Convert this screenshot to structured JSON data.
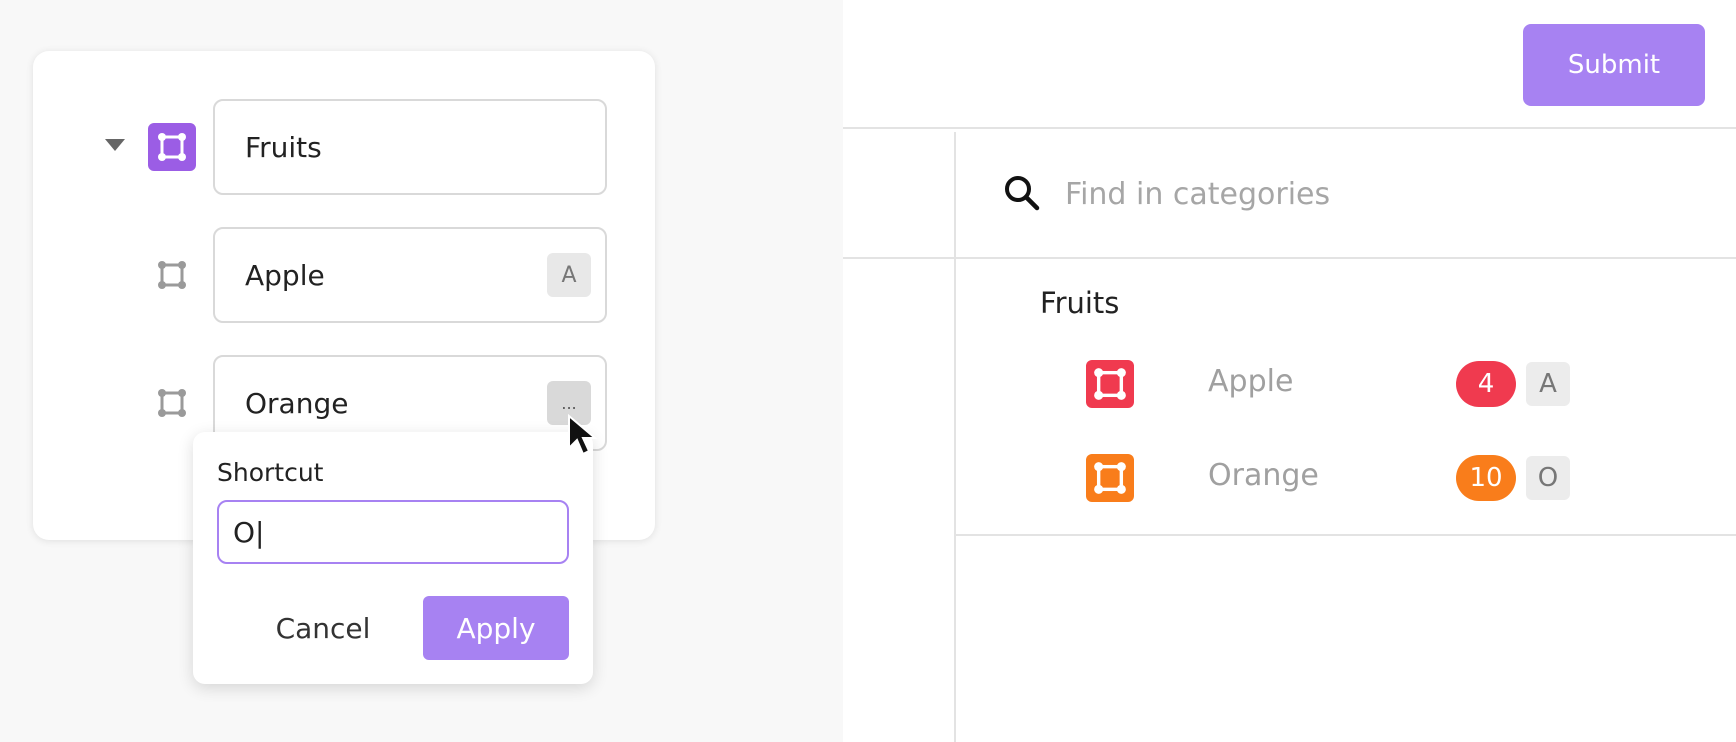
{
  "tree": {
    "items": [
      {
        "name": "Fruits",
        "icon": "category-icon",
        "expanded": true
      },
      {
        "name": "Apple",
        "icon": "category-icon",
        "shortcut": "A"
      },
      {
        "name": "Orange",
        "icon": "category-icon",
        "shortcut": "..."
      }
    ]
  },
  "popover": {
    "label": "Shortcut",
    "value": "O|",
    "cancel_label": "Cancel",
    "apply_label": "Apply"
  },
  "header": {
    "submit_label": "Submit"
  },
  "search": {
    "placeholder": "Find in categories"
  },
  "categories": {
    "group": "Fruits",
    "items": [
      {
        "name": "Apple",
        "count": "4",
        "shortcut": "A",
        "color": "#f03a4f"
      },
      {
        "name": "Orange",
        "count": "10",
        "shortcut": "O",
        "color": "#f97d1b"
      }
    ]
  },
  "colors": {
    "accent": "#a782f2",
    "node_purple": "#9b5de5",
    "apple_red": "#f03a4f",
    "orange": "#f97d1b"
  }
}
